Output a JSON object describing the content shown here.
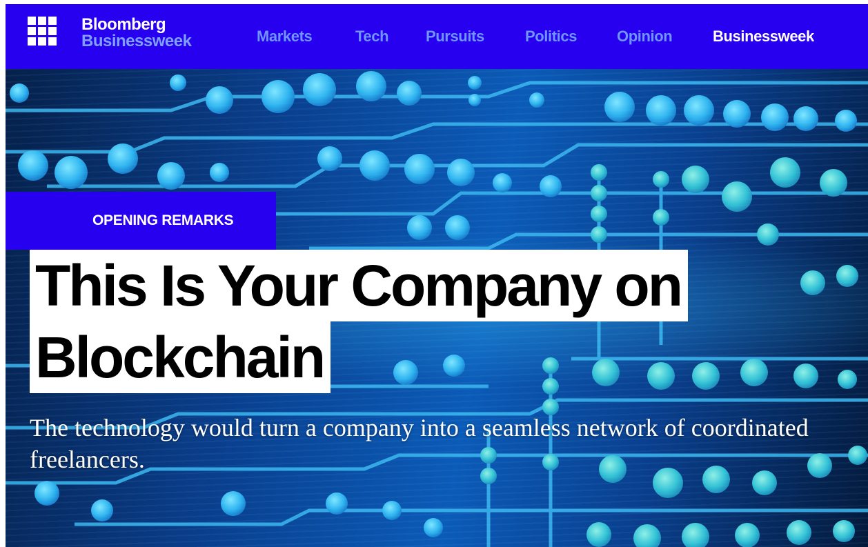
{
  "nav": {
    "logo_line1": "Bloomberg",
    "logo_line2": "Businessweek",
    "links": [
      {
        "label": "Markets"
      },
      {
        "label": "Tech"
      },
      {
        "label": "Pursuits"
      },
      {
        "label": "Politics"
      },
      {
        "label": "Opinion"
      },
      {
        "label": "Businessweek"
      }
    ],
    "active": "Businessweek",
    "background": "#2800f0",
    "link_color": "#6f95ff"
  },
  "article": {
    "kicker": "OPENING REMARKS",
    "headline_line1": "This Is Your Company on",
    "headline_line2": "Blockchain",
    "dek": "The technology would turn a company into a seamless network of coordinated freelancers."
  },
  "icons": {
    "menu": "grid-menu-icon"
  }
}
